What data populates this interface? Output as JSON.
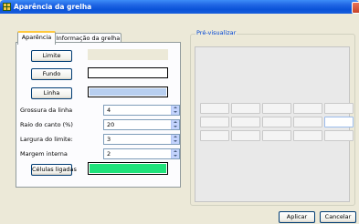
{
  "window": {
    "title": "Aparência da grelha"
  },
  "tabs": [
    {
      "label": "Aparência",
      "active": true
    },
    {
      "label": "Informação da grelha",
      "active": false
    }
  ],
  "appearance": {
    "limit_button": "Limite",
    "background_button": "Fundo",
    "line_button": "Linha",
    "limit_color": "#ECE9D8",
    "background_color": "#ffffff",
    "line_color": "#b8cff0",
    "rows": [
      {
        "label": "Grossura da linha",
        "value": "4"
      },
      {
        "label": "Raio do canto (%)",
        "value": "20"
      },
      {
        "label": "Largura do limite:",
        "value": "3"
      },
      {
        "label": "Margem interna",
        "value": "2"
      }
    ],
    "linked_cells_button": "Células ligadas",
    "linked_cells_color": "#1ee27a"
  },
  "preview": {
    "legend": "Pré-visualizar",
    "rows": 3,
    "cols": 5,
    "selected_cell": {
      "row": 1,
      "col": 4
    }
  },
  "footer": {
    "apply_label": "Aplicar",
    "cancel_label": "Cancelar"
  },
  "icons": {
    "window": "grid-icon",
    "close": "close-icon",
    "spinner": "spin-arrows-icon"
  }
}
